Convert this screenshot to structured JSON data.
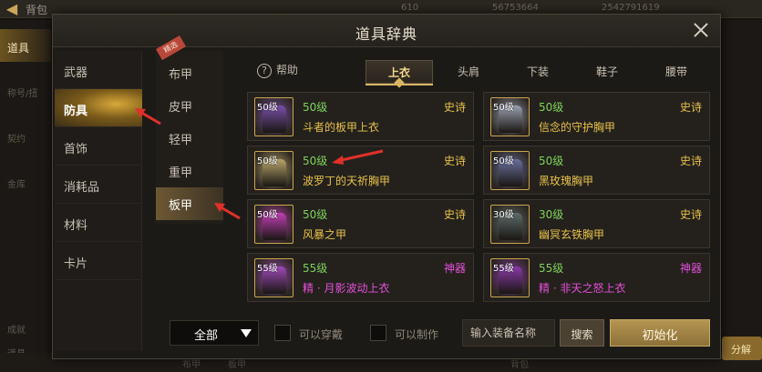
{
  "background": {
    "title": "背包",
    "resources": [
      "610",
      "56753664",
      "2542791619"
    ],
    "sidebar_items": [
      "道具",
      "称号/扭",
      "契约",
      "金库",
      "成就",
      "道具"
    ],
    "bottom_labels": [
      "布甲",
      "板甲",
      "背包",
      "分解"
    ],
    "right_button": "分解"
  },
  "dialog": {
    "title": "道具辞典",
    "close_label": "×"
  },
  "categories": [
    {
      "label": "武器",
      "active": false
    },
    {
      "label": "防具",
      "active": true
    },
    {
      "label": "首饰",
      "active": false
    },
    {
      "label": "消耗品",
      "active": false
    },
    {
      "label": "材料",
      "active": false
    },
    {
      "label": "卡片",
      "active": false
    }
  ],
  "subcategories": {
    "ribbon": "精选",
    "items": [
      {
        "label": "布甲",
        "active": false
      },
      {
        "label": "皮甲",
        "active": false
      },
      {
        "label": "轻甲",
        "active": false
      },
      {
        "label": "重甲",
        "active": false
      },
      {
        "label": "板甲",
        "active": true
      }
    ]
  },
  "help": {
    "icon": "question-icon",
    "label": "帮助"
  },
  "tabs": [
    {
      "label": "上衣",
      "active": true
    },
    {
      "label": "头肩",
      "active": false
    },
    {
      "label": "下装",
      "active": false
    },
    {
      "label": "鞋子",
      "active": false
    },
    {
      "label": "腰带",
      "active": false
    }
  ],
  "items": [
    {
      "thumb_level": "50级",
      "level": "50级",
      "rarity": "史诗",
      "name": "斗者的板甲上衣",
      "rarity_color": "#e8c14a",
      "name_color": "#e8c14a",
      "art_color": "#7a4fa8"
    },
    {
      "thumb_level": "50级",
      "level": "50级",
      "rarity": "史诗",
      "name": "信念的守护胸甲",
      "rarity_color": "#e8c14a",
      "name_color": "#e8c14a",
      "art_color": "#9aa0b0"
    },
    {
      "thumb_level": "50级",
      "level": "50级",
      "rarity": "史诗",
      "name": "波罗丁的天祈胸甲",
      "rarity_color": "#e8c14a",
      "name_color": "#e8c14a",
      "art_color": "#b8a46a"
    },
    {
      "thumb_level": "50级",
      "level": "50级",
      "rarity": "史诗",
      "name": "黑玫瑰胸甲",
      "rarity_color": "#e8c14a",
      "name_color": "#e8c14a",
      "art_color": "#6a6f9c"
    },
    {
      "thumb_level": "50级",
      "level": "50级",
      "rarity": "史诗",
      "name": "风暴之甲",
      "rarity_color": "#e8c14a",
      "name_color": "#e8c14a",
      "art_color": "#c23fb6"
    },
    {
      "thumb_level": "30级",
      "level": "30级",
      "rarity": "史诗",
      "name": "幽冥玄铁胸甲",
      "rarity_color": "#e8c14a",
      "name_color": "#e8c14a",
      "art_color": "#5e6b6a"
    },
    {
      "thumb_level": "55级",
      "level": "55级",
      "rarity": "神器",
      "name": "精 · 月影波动上衣",
      "rarity_color": "#e44fd8",
      "name_color": "#e44fd8",
      "art_color": "#a04ab8"
    },
    {
      "thumb_level": "55级",
      "level": "55级",
      "rarity": "神器",
      "name": "精 · 非天之怒上衣",
      "rarity_color": "#e44fd8",
      "name_color": "#e44fd8",
      "art_color": "#8a3aa8"
    }
  ],
  "filters": {
    "select_value": "全部",
    "can_wear_label": "可以穿戴",
    "can_craft_label": "可以制作",
    "search_placeholder": "输入装备名称",
    "search_button": "搜索",
    "reset_button": "初始化"
  },
  "colors": {
    "level_green": "#7ed25a",
    "epic_gold": "#e8c14a",
    "artifact_pink": "#e44fd8",
    "annotation_red": "#e0302a"
  }
}
